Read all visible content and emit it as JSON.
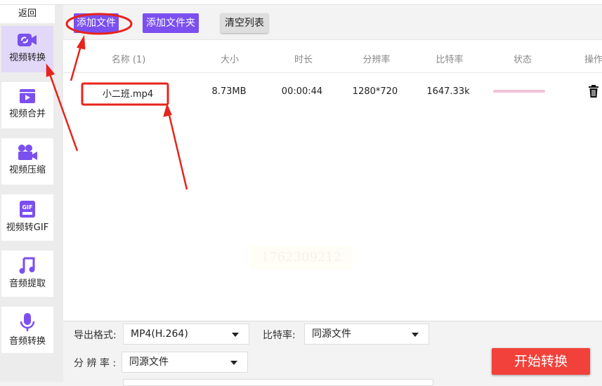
{
  "sidebar": {
    "back": "返回",
    "items": [
      {
        "label": "视频转换",
        "icon": "video-convert-icon"
      },
      {
        "label": "视频合并",
        "icon": "video-merge-icon"
      },
      {
        "label": "视频压缩",
        "icon": "video-compress-icon"
      },
      {
        "label": "视频转GIF",
        "icon": "gif-icon"
      },
      {
        "label": "音频提取",
        "icon": "music-note-icon"
      },
      {
        "label": "音频转换",
        "icon": "microphone-icon"
      }
    ]
  },
  "toolbar": {
    "add_file": "添加文件",
    "add_folder": "添加文件夹",
    "clear_list": "清空列表"
  },
  "table": {
    "headers": [
      "名称 (1)",
      "大小",
      "时长",
      "分辨率",
      "比特率",
      "状态",
      "操作"
    ],
    "rows": [
      {
        "name": "小二班.mp4",
        "size": "8.73MB",
        "duration": "00:00:44",
        "resolution": "1280*720",
        "bitrate": "1647.33k",
        "progress": 0
      }
    ]
  },
  "watermark": "1762309212",
  "settings": {
    "format_label": "导出格式:",
    "format_value": "MP4(H.264)",
    "bitrate_label": "比特率:",
    "bitrate_value": "同源文件",
    "resolution_label": "分 辨 率 :",
    "resolution_value": "同源文件"
  },
  "start_button": "开始转换",
  "colors": {
    "accent": "#7b4ff0",
    "start": "#f2413a",
    "annotation": "#e8231c"
  }
}
